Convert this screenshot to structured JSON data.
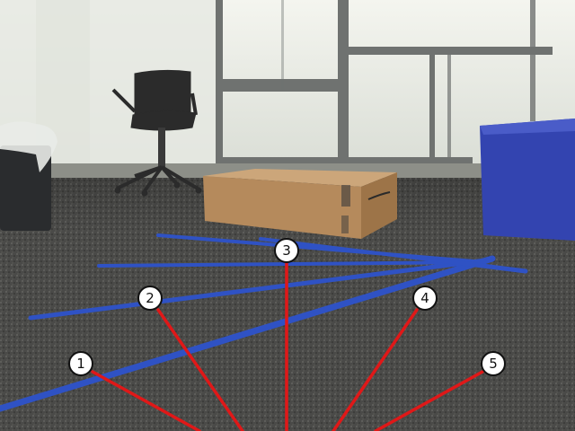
{
  "scene": {
    "colors": {
      "window_light": "#eef0ea",
      "frame": "#6f7270",
      "carpet": "#4a4a48",
      "tape": "#2f52c4",
      "ray": "#e01818",
      "bin_left": "#2a2c2e",
      "bin_right": "#3344b0",
      "box": "#b58a5c",
      "chair": "#2b2b2b"
    },
    "markers": [
      {
        "label": "1"
      },
      {
        "label": "2"
      },
      {
        "label": "3"
      },
      {
        "label": "4"
      },
      {
        "label": "5"
      }
    ]
  }
}
